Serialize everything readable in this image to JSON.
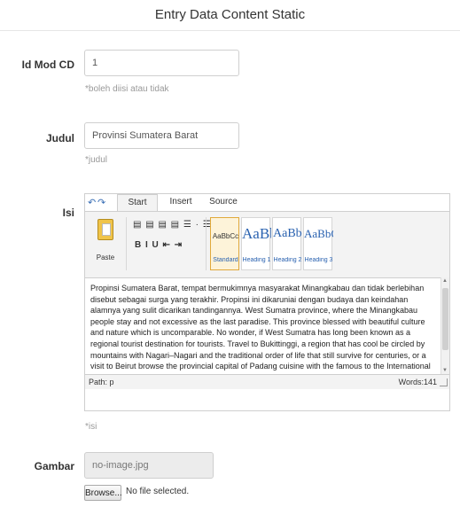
{
  "page": {
    "title": "Entry Data Content Static"
  },
  "form": {
    "id_mod_cd": {
      "label": "Id Mod CD",
      "value": "1",
      "help": "*boleh diisi atau tidak"
    },
    "judul": {
      "label": "Judul",
      "value": "Provinsi Sumatera Barat",
      "help": "*judul"
    },
    "isi": {
      "label": "Isi",
      "help": "*isi",
      "editor": {
        "undo_icon": "undo-icon",
        "redo_icon": "redo-icon",
        "tabs": [
          "Start",
          "Insert",
          "Source"
        ],
        "active_tab": "Start",
        "paste_label": "Paste",
        "toolbar_row1": "▤ ▤ ▤ ▤  ☰ · ☰ ·",
        "toolbar_row2": "B  I  U    ⇤ ⇥",
        "styles": [
          {
            "sample": "AaBbCc",
            "name": "Standard",
            "selected": true
          },
          {
            "sample": "AaBbC",
            "name": "Heading 1",
            "selected": false
          },
          {
            "sample": "AaBbCc",
            "name": "Heading 2",
            "selected": false
          },
          {
            "sample": "AaBbCc",
            "name": "Heading 3",
            "selected": false
          }
        ],
        "content": "Propinsi Sumatera Barat, tempat bermukimnya masyarakat Minangkabau dan tidak berlebihan disebut sebagai surga yang terakhir. Propinsi ini dikaruniai dengan budaya dan keindahan alamnya yang sulit dicarikan tandingannya. West Sumatra province, where the Minangkabau people stay and not excessive as the last paradise. This province blessed with beautiful culture and nature which is uncomparable. No wonder, if West Sumatra has long been known as a regional tourist destination for tourists. Travel to Bukittinggi, a region that has cool be circled by mountains with Nagari–Nagari and the traditional order of life that still survive for centuries, or a visit to Beirut browse the provincial capital of Padang cuisine with the famous to the International Community, and travel to regions of the natural reserve that all will never forget",
        "path": "Path: p",
        "words": "Words:141"
      }
    },
    "gambar": {
      "label": "Gambar",
      "value": "no-image.jpg",
      "browse_label": "Browse...",
      "file_status": "No file selected."
    }
  }
}
